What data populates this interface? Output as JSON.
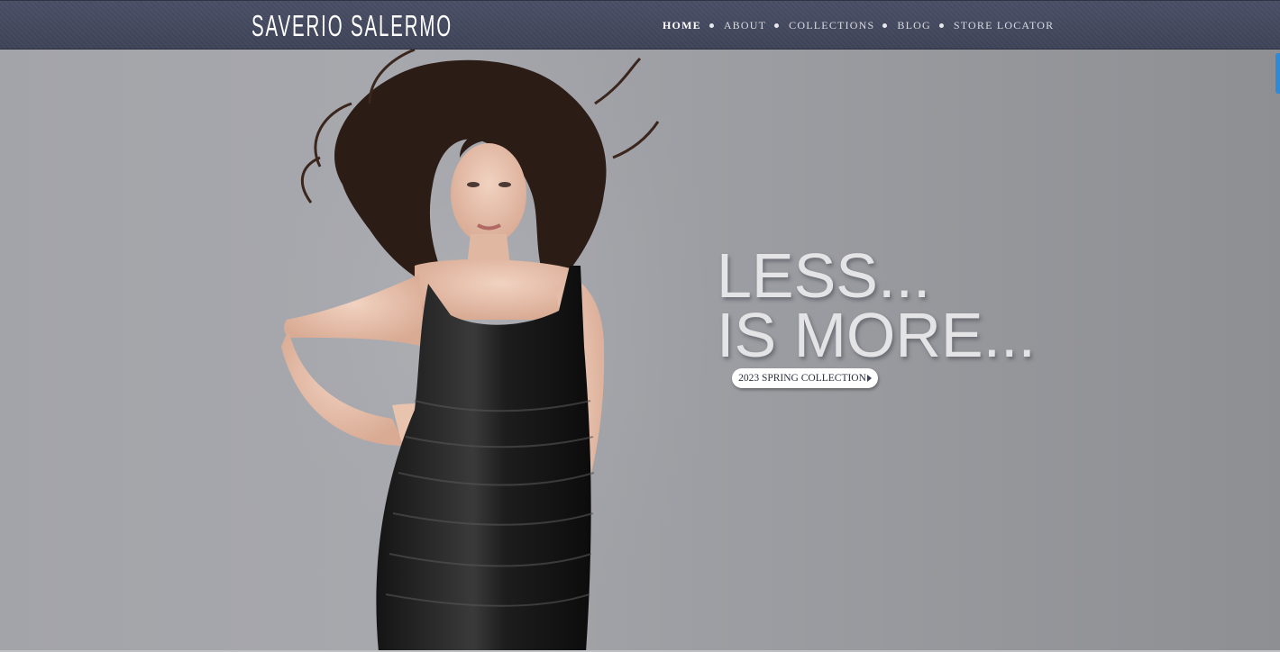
{
  "brand": {
    "logo_text": "SAVERIO SALERMO"
  },
  "nav": {
    "items": [
      {
        "label": "HOME",
        "active": true
      },
      {
        "label": "ABOUT",
        "active": false
      },
      {
        "label": "COLLECTIONS",
        "active": false
      },
      {
        "label": "BLOG",
        "active": false
      },
      {
        "label": "STORE LOCATOR",
        "active": false
      }
    ]
  },
  "hero": {
    "headline_line1": "LESS...",
    "headline_line2": "IS MORE...",
    "cta_label": "2023 SPRING COLLECTION",
    "image_subject": "model-in-black-satin-dress"
  },
  "colors": {
    "nav_bg": "#434860",
    "hero_bg": "#9a9ba0",
    "headline": "#e4e4e6",
    "cta_bg": "#ffffff",
    "side_tab": "#2c8ad9"
  }
}
